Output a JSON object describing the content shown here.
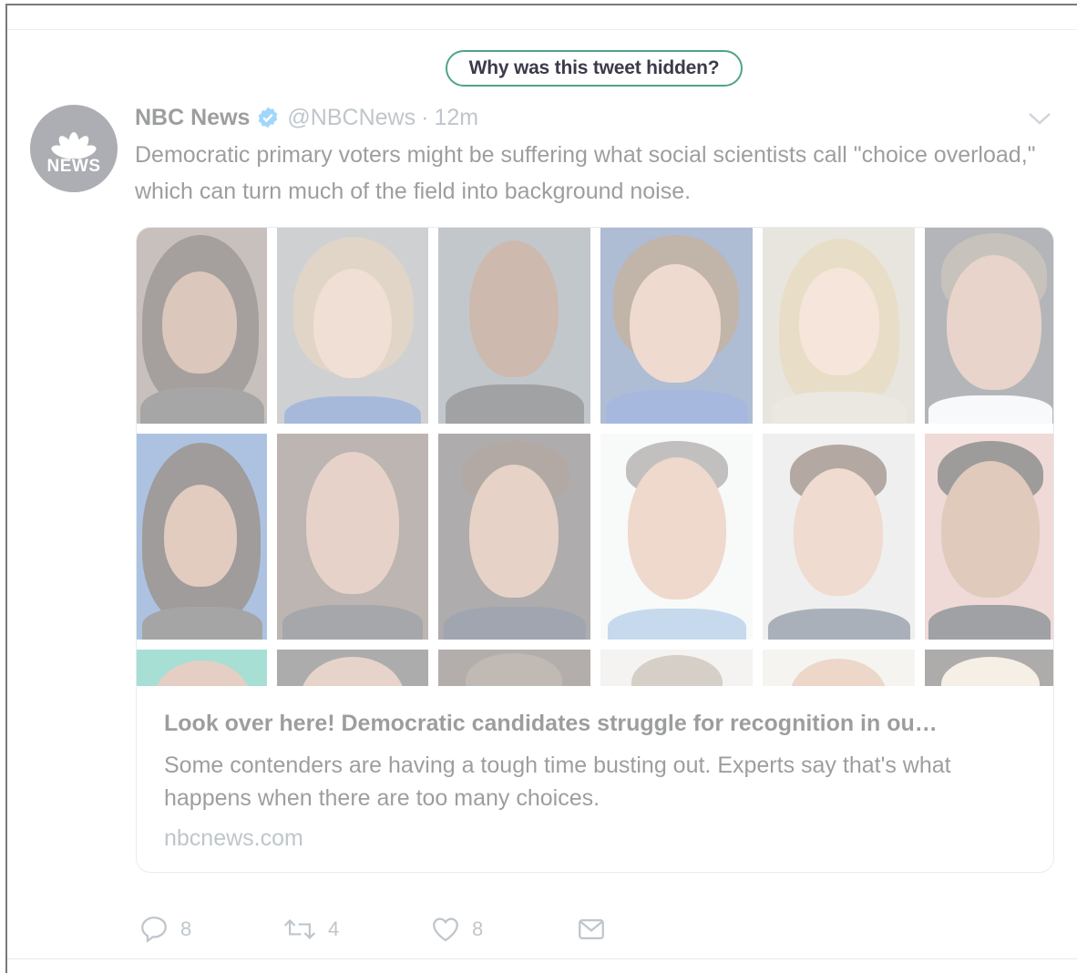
{
  "hidden_notice": {
    "button_label": "Why was this tweet hidden?"
  },
  "tweet": {
    "avatar_text": "NEWS",
    "author_name": "NBC News",
    "handle": "@NBCNews",
    "separator": "·",
    "timestamp": "12m",
    "text": "Democratic primary voters might be suffering what social scientists call \"choice overload,\" which can turn much of the field into background noise.",
    "card": {
      "title": "Look over here! Democratic candidates struggle for recognition in ou…",
      "description": "Some contenders are having a tough time busting out. Experts say that's what happens when there are too many choices.",
      "domain": "nbcnews.com"
    },
    "actions": {
      "reply_count": "8",
      "retweet_count": "4",
      "like_count": "8"
    }
  },
  "icons": {
    "verified": "verified-badge-icon",
    "caret": "chevron-down-icon",
    "reply": "reply-icon",
    "retweet": "retweet-icon",
    "like": "heart-icon",
    "dm": "envelope-icon"
  },
  "colors": {
    "button_border": "#4fa38c",
    "verified_blue": "#1da1f2",
    "avatar_bg": "#3a3f4b",
    "muted_text": "#657786"
  }
}
